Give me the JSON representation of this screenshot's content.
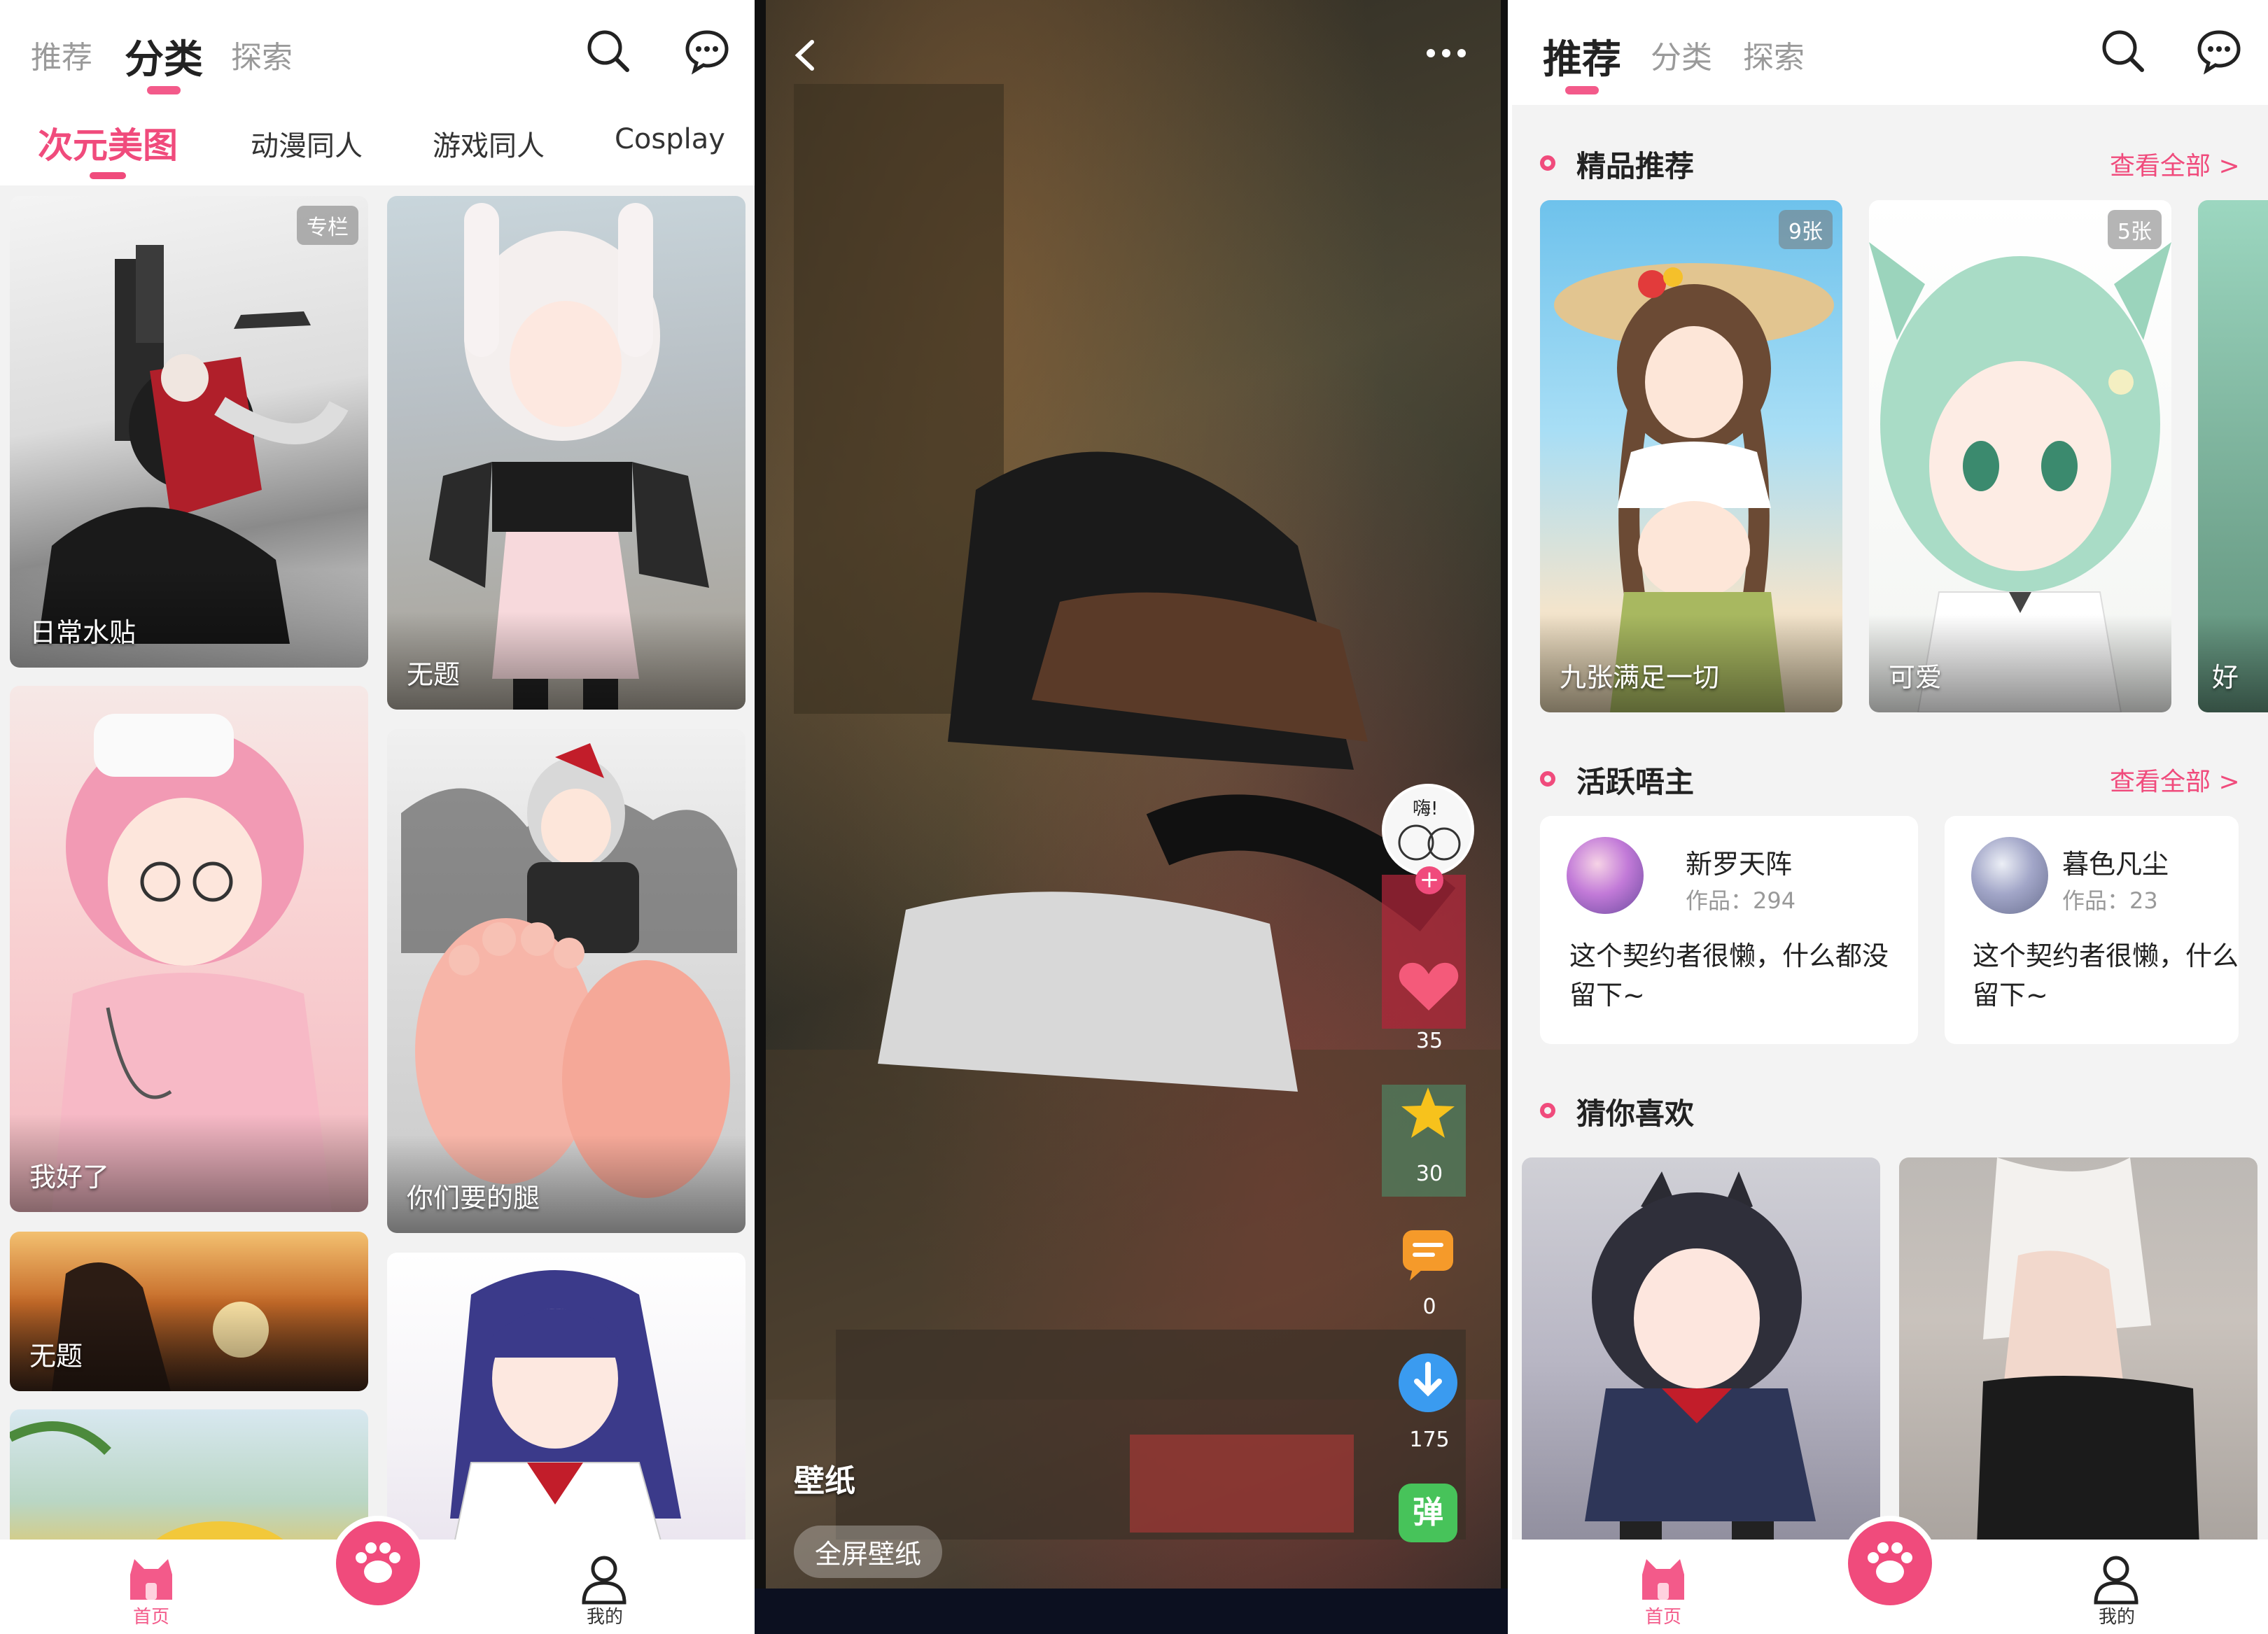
{
  "left_panel": {
    "top_tabs": [
      "推荐",
      "分类",
      "探索"
    ],
    "active_top_tab": "分类",
    "sub_tabs": [
      "次元美图",
      "动漫同人",
      "游戏同人",
      "Cosplay"
    ],
    "active_sub_tab": "次元美图",
    "cards": [
      {
        "caption": "日常水贴",
        "badge": "专栏"
      },
      {
        "caption": "无题"
      },
      {
        "caption": "我好了"
      },
      {
        "caption": "你们要的腿"
      },
      {
        "caption": "无题"
      },
      {
        "caption": ""
      },
      {
        "caption": ""
      }
    ],
    "bottom_nav": {
      "home": "首页",
      "me": "我的"
    }
  },
  "viewer_panel": {
    "category_label": "壁纸",
    "fullscreen_button": "全屏壁纸",
    "like_count": "35",
    "star_count": "30",
    "comment_count": "0",
    "download_count": "175",
    "danmaku_label": "弹",
    "author_avatar_text": "嗨!"
  },
  "right_panel": {
    "top_tabs": [
      "推荐",
      "分类",
      "探索"
    ],
    "active_top_tab": "推荐",
    "featured": {
      "title": "精品推荐",
      "see_all": "查看全部 >",
      "items": [
        {
          "caption": "九张满足一切",
          "badge": "9张"
        },
        {
          "caption": "可爱",
          "badge": "5张"
        },
        {
          "caption": "好"
        }
      ]
    },
    "active_creators": {
      "title": "活跃唔主",
      "see_all": "查看全部 >",
      "items": [
        {
          "name": "新罗天阵",
          "works": "作品：294",
          "bio_line1": "这个契约者很懒，什么都没",
          "bio_line2": "留下~"
        },
        {
          "name": "暮色凡尘",
          "works": "作品：23",
          "bio_line1": "这个契约者很懒，什么都",
          "bio_line2": "留下~"
        }
      ]
    },
    "guess": {
      "title": "猜你喜欢"
    },
    "bottom_nav": {
      "home": "首页",
      "me": "我的"
    }
  },
  "colors": {
    "accent": "#f04b7c",
    "brand_pink": "#f35a8a",
    "star": "#f7c21c",
    "comment": "#f59a2a",
    "download": "#3a9bf0",
    "danmaku": "#47c35a"
  }
}
